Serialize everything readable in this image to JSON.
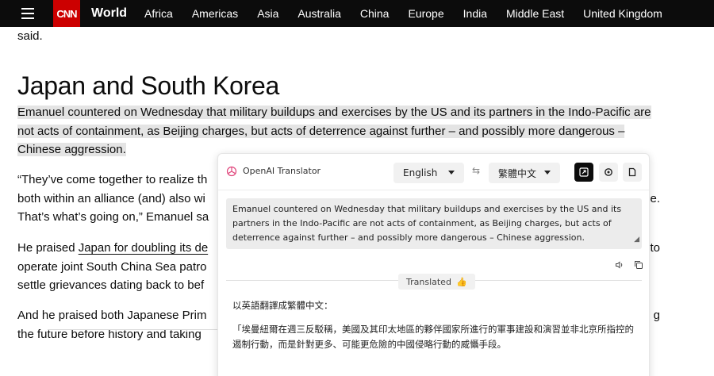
{
  "nav": {
    "logo": "CNN",
    "section": "World",
    "links": [
      "Africa",
      "Americas",
      "Asia",
      "Australia",
      "China",
      "Europe",
      "India",
      "Middle East",
      "United Kingdom"
    ]
  },
  "article": {
    "fragment": "said.",
    "heading": "Japan and South Korea",
    "p1": "Emanuel countered on Wednesday that military buildups and exercises by the US and its partners in the Indo-Pacific are not acts of containment, as Beijing charges, but acts of deterrence against further – and possibly more dangerous – Chinese aggression.",
    "p2": "“They’ve come together to realize th... both within an alliance (and) also wi... That’s what’s going on,” Emanuel sa...",
    "p2_l1a": "“They’ve come together to realize th",
    "p2_l1b": "",
    "p2_l2a": "both within an alliance (and) also wi",
    "p2_l2b": "e.",
    "p2_l3a": "That’s what’s going on,” Emanuel sa",
    "p3_l1a": "He praised ",
    "p3_link": "Japan for doubling its de",
    "p3_l1b": "to",
    "p3_l2a": "operate joint South China Sea patro",
    "p3_l3a": "settle grievances dating back to bef",
    "p4_l1a": "And he praised both Japanese Prim",
    "p4_l1b": "g",
    "p4_l2a": "the future before history and taking"
  },
  "translator": {
    "title": "OpenAI Translator",
    "from_lang": "English",
    "swap_icon": "⇆",
    "to_lang": "繁體中文",
    "source_text": "Emanuel countered on Wednesday that military buildups and exercises by the US and its partners in the Indo-Pacific are not acts of containment, as Beijing charges, but acts of deterrence against further – and possibly more dangerous – Chinese aggression.",
    "status_label": "Translated",
    "status_emoji": "👍",
    "output_intro": "以英語翻譯成繁體中文：",
    "output_text": "「埃曼紐爾在週三反駁稱，美國及其印太地區的夥伴國家所進行的軍事建設和演習並非北京所指控的遏制行動，而是針對更多、可能更危險的中國侵略行動的威懾手段。",
    "colors": {
      "accent_button": "#0c0c0c",
      "source_bg": "#ececec"
    }
  },
  "colors": {
    "brand": "#cc0000",
    "nav_bg": "#0c0c0c",
    "highlight": "#e4e4e4"
  }
}
